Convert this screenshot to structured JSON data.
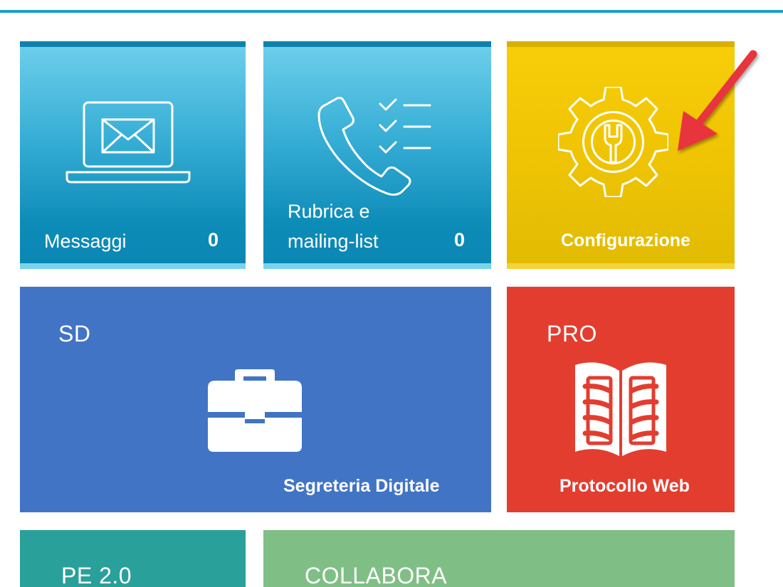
{
  "colors": {
    "accent_line": "#1a9fca",
    "messaggi": "#1aa0cc",
    "rubrica": "#1aa0cc",
    "configurazione": "#efc404",
    "sd": "#4174c4",
    "pro": "#e23d2f",
    "pe": "#2aa09b",
    "collabora": "#7fbf86",
    "annotation_arrow": "#e8343e"
  },
  "tiles": {
    "messaggi": {
      "label": "Messaggi",
      "count": "0",
      "icon": "laptop-mail-icon"
    },
    "rubrica": {
      "label_line1": "Rubrica e",
      "label_line2": "mailing-list",
      "count": "0",
      "icon": "phone-checklist-icon"
    },
    "configurazione": {
      "label": "Configurazione",
      "icon": "gear-wrench-icon"
    },
    "sd": {
      "code": "SD",
      "name": "Segreteria Digitale",
      "icon": "briefcase-icon"
    },
    "pro": {
      "code": "PRO",
      "name": "Protocollo Web",
      "icon": "open-book-icon"
    },
    "pe": {
      "code": "PE 2.0"
    },
    "collabora": {
      "code": "COLLABORA"
    }
  }
}
